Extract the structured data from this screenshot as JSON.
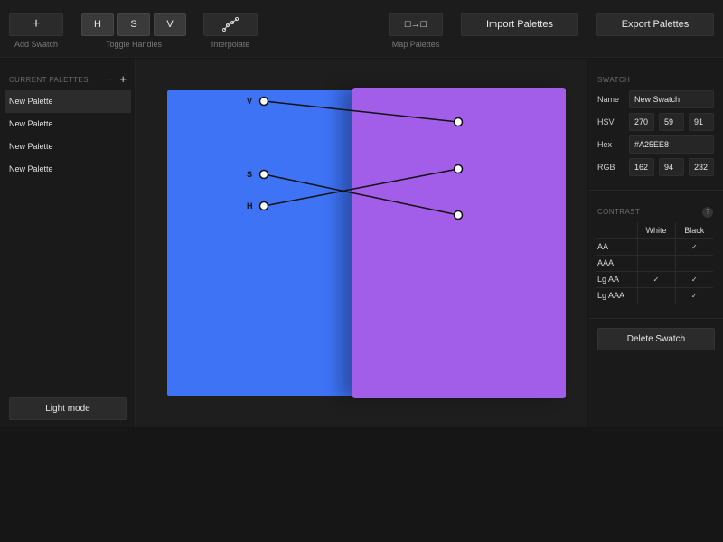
{
  "toolbar": {
    "add_swatch": {
      "icon": "+",
      "caption": "Add Swatch"
    },
    "toggle_handles": {
      "buttons": [
        "H",
        "S",
        "V"
      ],
      "caption": "Toggle Handles"
    },
    "interpolate": {
      "icon": "interpolate-curve-icon",
      "caption": "Interpolate"
    },
    "map_palettes": {
      "icon": "□→□",
      "caption": "Map Palettes"
    },
    "import_label": "Import Palettes",
    "export_label": "Export Palettes"
  },
  "sidebar": {
    "title": "CURRENT PALETTES",
    "remove_icon": "−",
    "add_icon": "+",
    "palettes": [
      {
        "name": "New Palette",
        "selected": true
      },
      {
        "name": "New Palette",
        "selected": false
      },
      {
        "name": "New Palette",
        "selected": false
      },
      {
        "name": "New Palette",
        "selected": false
      }
    ],
    "mode_button": "Light mode"
  },
  "canvas": {
    "swatch_a_color": "#3E73F6",
    "swatch_b_color": "#A25EE8",
    "handle_labels": {
      "v": "V",
      "s": "S",
      "h": "H"
    }
  },
  "swatch": {
    "title": "SWATCH",
    "name_label": "Name",
    "name_value": "New Swatch",
    "hsv_label": "HSV",
    "hsv": [
      "270",
      "59",
      "91"
    ],
    "hex_label": "Hex",
    "hex_value": "#A25EE8",
    "rgb_label": "RGB",
    "rgb": [
      "162",
      "94",
      "232"
    ]
  },
  "contrast": {
    "title": "CONTRAST",
    "help_icon": "?",
    "columns": [
      "White",
      "Black"
    ],
    "check_glyph": "✓",
    "rows": [
      {
        "label": "AA",
        "white": false,
        "black": true
      },
      {
        "label": "AAA",
        "white": false,
        "black": false
      },
      {
        "label": "Lg AA",
        "white": true,
        "black": true
      },
      {
        "label": "Lg AAA",
        "white": false,
        "black": true
      }
    ]
  },
  "delete_button": "Delete Swatch"
}
